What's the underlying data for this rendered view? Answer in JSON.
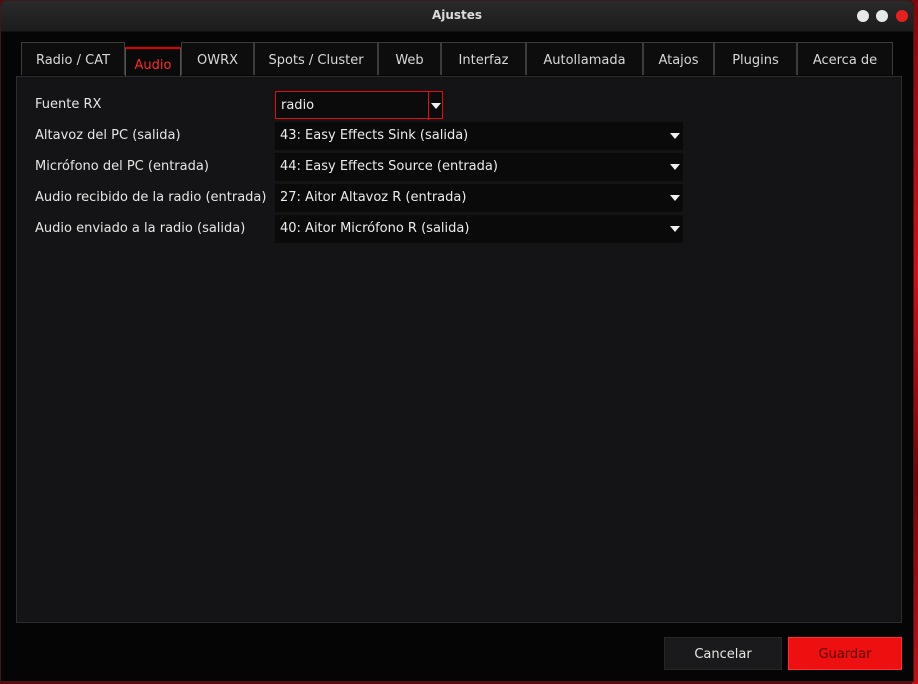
{
  "window": {
    "title": "Ajustes"
  },
  "tabs": [
    {
      "label": "Radio / CAT",
      "active": false
    },
    {
      "label": "Audio",
      "active": true
    },
    {
      "label": "OWRX",
      "active": false
    },
    {
      "label": "Spots / Cluster",
      "active": false
    },
    {
      "label": "Web",
      "active": false
    },
    {
      "label": "Interfaz",
      "active": false
    },
    {
      "label": "Autollamada",
      "active": false
    },
    {
      "label": "Atajos",
      "active": false
    },
    {
      "label": "Plugins",
      "active": false
    },
    {
      "label": "Acerca de",
      "active": false
    }
  ],
  "audio": {
    "rows": [
      {
        "label": "Fuente RX",
        "value": "radio"
      },
      {
        "label": "Altavoz del PC (salida)",
        "value": "43: Easy Effects Sink (salida)"
      },
      {
        "label": "Micrófono del PC (entrada)",
        "value": "44: Easy Effects Source (entrada)"
      },
      {
        "label": "Audio recibido de la radio (entrada)",
        "value": "27: Aitor Altavoz R (entrada)"
      },
      {
        "label": "Audio enviado a la radio (salida)",
        "value": "40: Aitor Micrófono R (salida)"
      }
    ]
  },
  "buttons": {
    "cancel": "Cancelar",
    "save": "Guardar"
  },
  "colors": {
    "accent": "#e01010",
    "background": "#050505",
    "panel": "#141416",
    "text": "#e6e6e6"
  }
}
